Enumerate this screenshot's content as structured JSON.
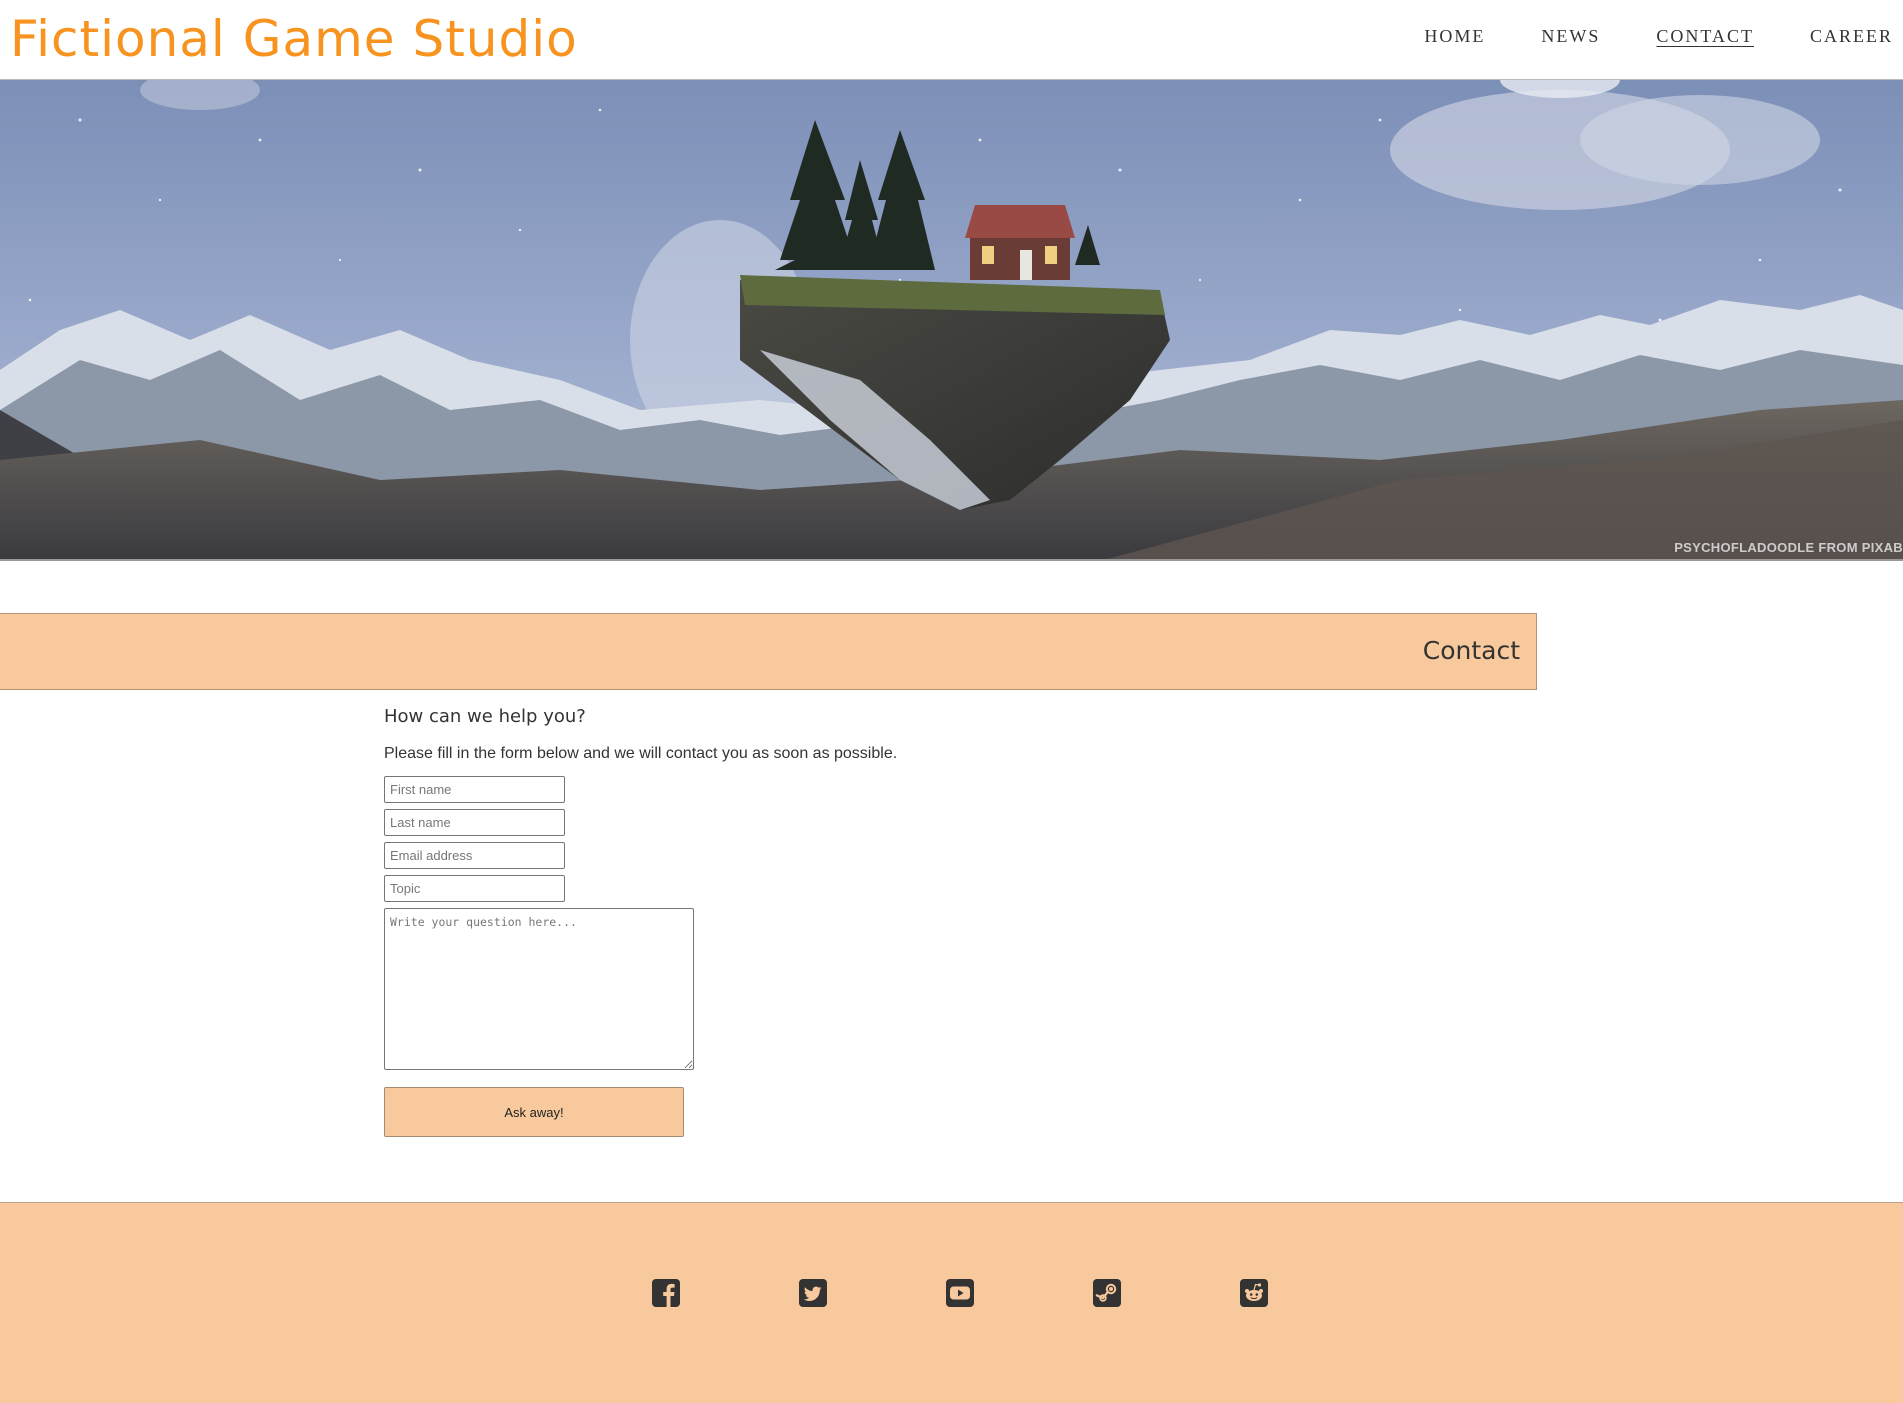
{
  "header": {
    "brand": "Fictional Game Studio",
    "nav": [
      "HOME",
      "NEWS",
      "CONTACT",
      "CAREER"
    ],
    "active_nav": "CONTACT"
  },
  "hero": {
    "credit": "PSYCHOFLADOODLE FROM PIXAB"
  },
  "section": {
    "title": "Contact"
  },
  "form": {
    "heading": "How can we help you?",
    "intro": "Please fill in the form below and we will contact you as soon as possible.",
    "first_name_placeholder": "First name",
    "last_name_placeholder": "Last name",
    "email_placeholder": "Email address",
    "topic_placeholder": "Topic",
    "question_placeholder": "Write your question here...",
    "submit_label": "Ask away!"
  },
  "footer": {
    "social_icons": [
      "facebook-icon",
      "twitter-icon",
      "youtube-icon",
      "steam-icon",
      "reddit-icon"
    ]
  },
  "colors": {
    "brand": "#F7931E",
    "accent_bg": "#F8C99C",
    "text": "#333333"
  }
}
